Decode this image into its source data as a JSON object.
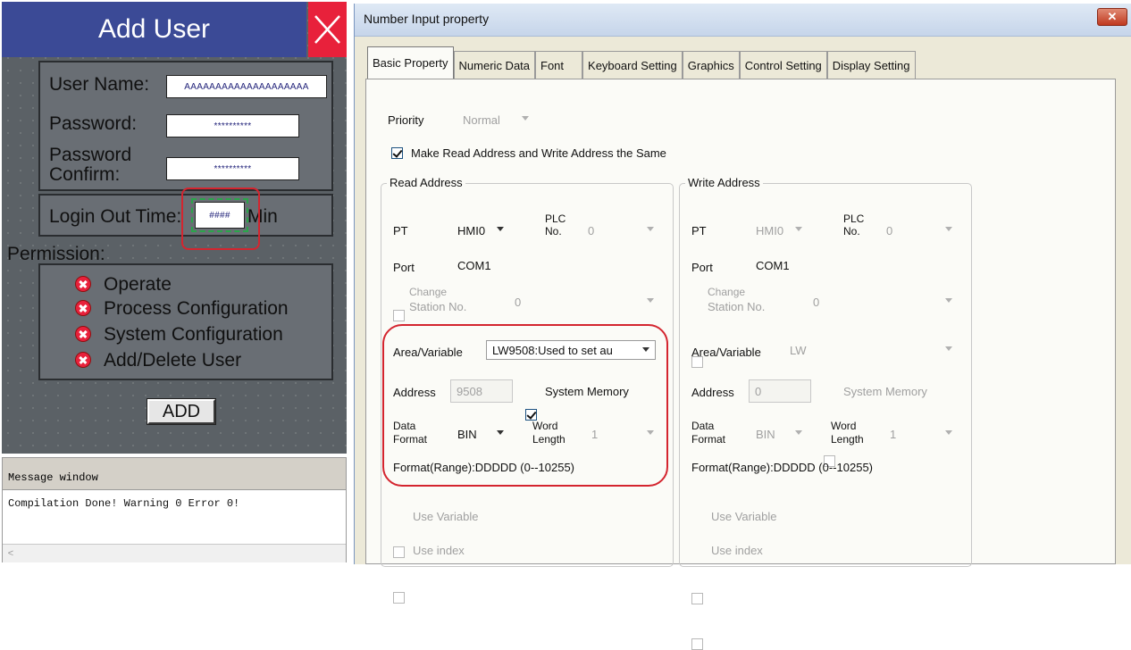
{
  "hmi": {
    "title": "Add User",
    "user_name_label": "User Name:",
    "user_name_value": "AAAAAAAAAAAAAAAAAAAA",
    "password_label": "Password:",
    "password_value": "**********",
    "confirm_label_1": "Password",
    "confirm_label_2": "Confirm:",
    "confirm_value": "**********",
    "login_label": "Login Out Time:",
    "login_value": "####",
    "login_unit": "Min",
    "permission_label": "Permission:",
    "permissions": [
      "Operate",
      "Process Configuration",
      "System Configuration",
      "Add/Delete User"
    ],
    "add_label": "ADD"
  },
  "message_window": {
    "title": "Message window",
    "text": "Compilation Done! Warning 0 Error 0!",
    "scroll_left_glyph": "<"
  },
  "dialog": {
    "title": "Number Input property",
    "close_glyph": "✕",
    "tabs": [
      "Basic Property",
      "Numeric Data",
      "Font",
      "Keyboard Setting",
      "Graphics",
      "Control Setting",
      "Display Setting"
    ],
    "priority_label": "Priority",
    "priority_value": "Normal",
    "same_address_label": "Make Read Address and Write Address the Same",
    "read": {
      "title": "Read Address",
      "pt_label": "PT",
      "pt_value": "HMI0",
      "plc_label_1": "PLC",
      "plc_label_2": "No.",
      "plc_value": "0",
      "port_label": "Port",
      "port_value": "COM1",
      "change_label_1": "Change",
      "change_label_2": "Station No.",
      "change_value": "0",
      "area_label": "Area/Variable",
      "area_value": "LW9508:Used to set au",
      "address_label": "Address",
      "address_value": "9508",
      "system_memory_label": "System Memory",
      "data_format_label_1": "Data",
      "data_format_label_2": "Format",
      "data_format_value": "BIN",
      "word_length_label_1": "Word",
      "word_length_label_2": "Length",
      "word_length_value": "1",
      "range_text": "Format(Range):DDDDD (0--10255)",
      "use_variable": "Use Variable",
      "use_index": "Use index"
    },
    "write": {
      "title": "Write Address",
      "pt_label": "PT",
      "pt_value": "HMI0",
      "plc_label_1": "PLC",
      "plc_label_2": "No.",
      "plc_value": "0",
      "port_label": "Port",
      "port_value": "COM1",
      "change_label_1": "Change",
      "change_label_2": "Station No.",
      "change_value": "0",
      "area_label": "Area/Variable",
      "area_value": "LW",
      "address_label": "Address",
      "address_value": "0",
      "system_memory_label": "System Memory",
      "data_format_label_1": "Data",
      "data_format_label_2": "Format",
      "data_format_value": "BIN",
      "word_length_label_1": "Word",
      "word_length_label_2": "Length",
      "word_length_value": "1",
      "range_text": "Format(Range):DDDDD (0--10255)",
      "use_variable": "Use Variable",
      "use_index": "Use index"
    }
  },
  "colors": {
    "hmi_title_bg": "#3b4a96",
    "hmi_close_bg": "#e8213b",
    "highlight": "#d4252f",
    "dialog_bg": "#ece9d8"
  }
}
